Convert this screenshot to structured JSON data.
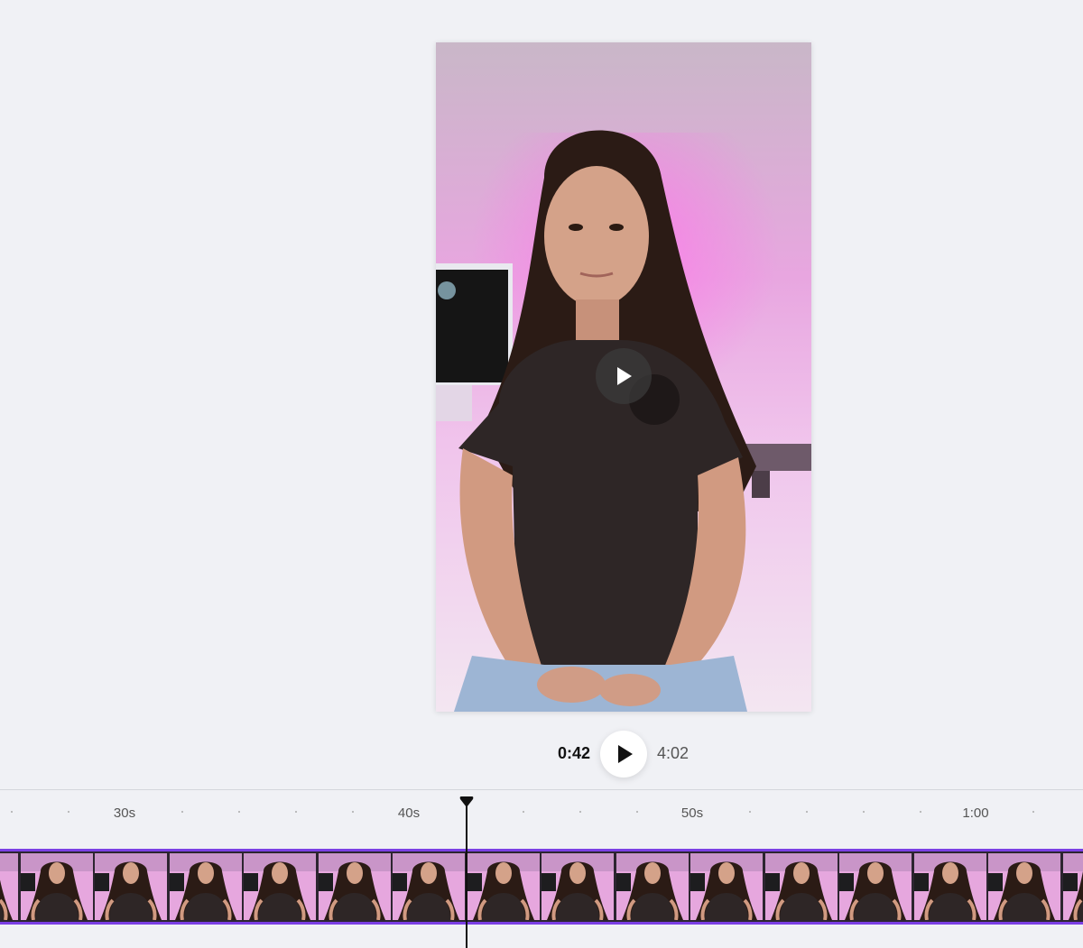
{
  "player": {
    "current_time": "0:42",
    "total_time": "4:02",
    "preview_icon": "play-icon",
    "main_play_icon": "play-icon"
  },
  "timeline": {
    "ruler_labels": [
      "30s",
      "40s",
      "50s",
      "1:00"
    ],
    "playhead_position": "0:42",
    "accent_color": "#7b3fe4"
  },
  "colors": {
    "background": "#f0f1f5",
    "clip_border": "#7b3fe4",
    "text_primary": "#111111",
    "text_secondary": "#555555"
  }
}
